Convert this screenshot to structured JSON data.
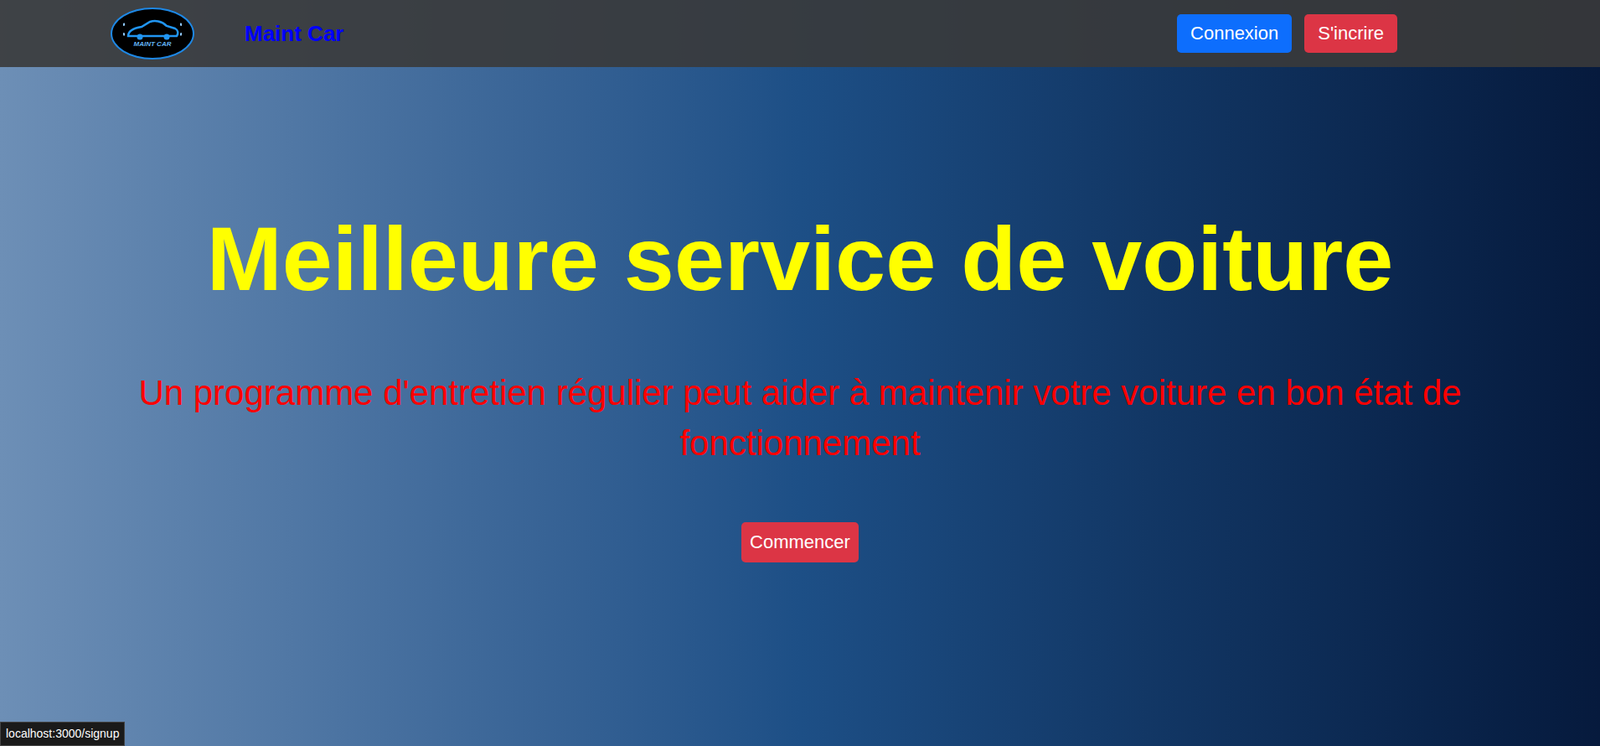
{
  "header": {
    "logo_text": "MAINT CAR",
    "brand": "Maint Car",
    "buttons": [
      {
        "label": "Connexion",
        "color": "#0d6efd"
      },
      {
        "label": "S'incrire",
        "color": "#dc3545"
      }
    ]
  },
  "hero": {
    "title": "Meilleure service de voiture",
    "subtitle": "Un programme d'entretien régulier peut aider à maintenir votre voiture en bon état de fonctionnement",
    "button": "Commencer"
  },
  "status_bar": {
    "url": "localhost:3000/signup"
  }
}
